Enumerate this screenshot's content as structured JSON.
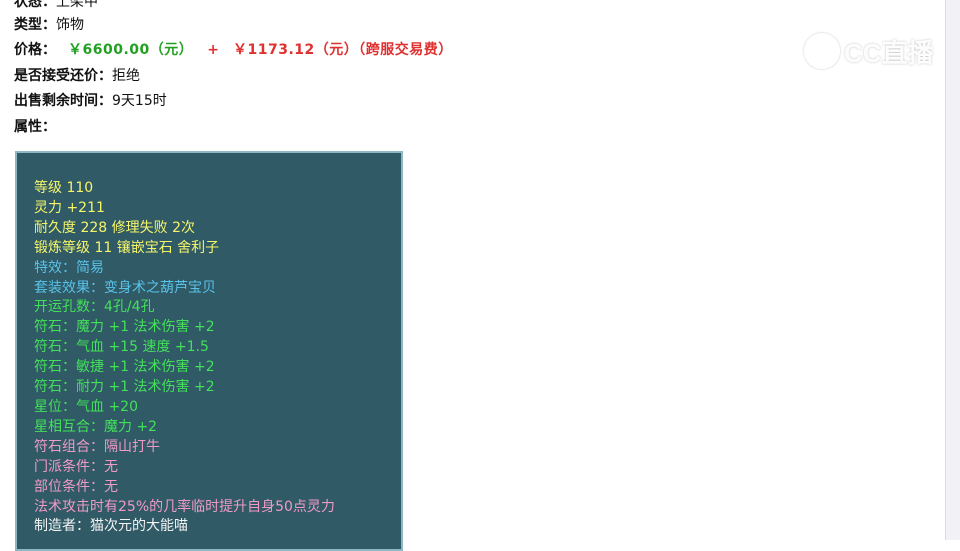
{
  "listing": {
    "status_label": "状态：",
    "status_value": "上架中",
    "type_label": "类型：",
    "type_value": "饰物",
    "price_label": "价格：",
    "price_main": "￥6600.00（元）",
    "price_plus": "+",
    "price_fee": "￥1173.12（元）（跨服交易费）",
    "counteroffer_label": "是否接受还价：",
    "counteroffer_value": "拒绝",
    "remaining_label": "出售剩余时间：",
    "remaining_value": "9天15时",
    "attributes_label": "属性："
  },
  "attributes": {
    "level": "等级 110",
    "spirit": "灵力 +211",
    "durability": "耐久度 228 修理失败 2次",
    "forging": "锻炼等级 11 镶嵌宝石 舍利子",
    "special_effect": "特效：简易",
    "set_effect": "套装效果：变身术之葫芦宝贝",
    "slots": "开运孔数：4孔/4孔",
    "runes": [
      "符石：魔力 +1 法术伤害 +2",
      "符石：气血 +15 速度 +1.5",
      "符石：敏捷 +1 法术伤害 +2",
      "符石：耐力 +1 法术伤害 +2"
    ],
    "star_position": "星位：气血 +20",
    "star_harmony": "星相互合：魔力 +2",
    "rune_combo": "符石组合：隔山打牛",
    "sect_requirement": "门派条件：无",
    "part_requirement": "部位条件：无",
    "combo_effect": "法术攻击时有25%的几率临时提升自身50点灵力",
    "cutoff_line": "制造者：猫次元的大能喵"
  },
  "watermark": {
    "text": "CC直播",
    "icon": "cc-live-logo-icon"
  },
  "colors": {
    "panel_bg": "#2f5a66",
    "yellow": "#f5f56a",
    "cyan": "#59c2e8",
    "green": "#44e05a",
    "pink": "#f09ac8",
    "price_green": "#22a022",
    "price_red": "#e03030"
  }
}
